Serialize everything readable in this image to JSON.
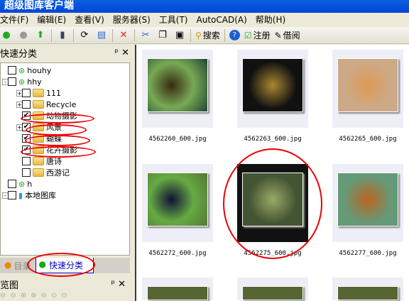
{
  "title": "超级图库客户端",
  "menu": [
    "文件(F)",
    "编辑(E)",
    "查看(V)",
    "服务器(S)",
    "工具(T)",
    "AutoCAD(A)",
    "帮助(H)"
  ],
  "toolbar": {
    "search": "搜索",
    "register": "注册",
    "borrow": "借阅"
  },
  "left_panel": {
    "title": "快速分类",
    "tabs": [
      "目录",
      "快速分类"
    ],
    "active_tab": "快速分类",
    "bottom_title": "览图"
  },
  "tree": [
    {
      "label": "houhy",
      "checked": false
    },
    {
      "label": "hhy",
      "checked": false
    },
    {
      "label": "111",
      "checked": false
    },
    {
      "label": "Recycle",
      "checked": false
    },
    {
      "label": "动物摄影",
      "checked": true
    },
    {
      "label": "风景",
      "checked": true
    },
    {
      "label": "蝴蝶",
      "checked": true
    },
    {
      "label": "花卉摄影",
      "checked": true
    },
    {
      "label": "唐诗",
      "checked": false
    },
    {
      "label": "西游记",
      "checked": false
    },
    {
      "label": "h",
      "checked": false
    },
    {
      "label": "本地图库",
      "checked": false
    }
  ],
  "thumbnails": [
    "4562260_600.jpg",
    "4562263_600.jpg",
    "4562265_600.jpg",
    "4562272_600.jpg",
    "4562275_600.jpg",
    "4562277_600.jpg"
  ],
  "selected_thumbnail": "4562275_600.jpg"
}
